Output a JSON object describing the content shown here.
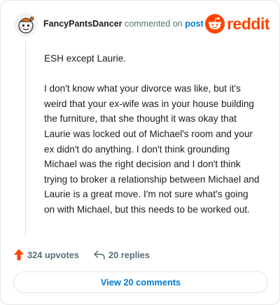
{
  "header": {
    "username": "FancyPantsDancer",
    "action_text": "commented on",
    "post_link": "post",
    "brand": "reddit"
  },
  "comment": {
    "paragraphs": [
      "ESH except Laurie.",
      "I don't know what your divorce was like, but it's weird that your ex-wife was in your house building the furniture, that she thought it was okay that Laurie was locked out of Michael's room and your ex didn't do anything. I don't think grounding Michael was the right decision and I don't think trying to broker a relationship between Michael and Laurie is a great move. I'm not sure what's going on with Michael, but this needs to be worked out."
    ]
  },
  "actions": {
    "upvotes": "324 upvotes",
    "replies": "20 replies"
  },
  "footer": {
    "view_comments": "View 20 comments"
  },
  "colors": {
    "brand": "#ff4500",
    "link": "#0079d3",
    "meta": "#576f76",
    "text": "#1c1c1c"
  },
  "icons": {
    "avatar": "snoo-avatar-icon",
    "brand": "reddit-logo-icon",
    "upvote": "upvote-arrow-icon",
    "reply": "reply-arrow-icon"
  }
}
